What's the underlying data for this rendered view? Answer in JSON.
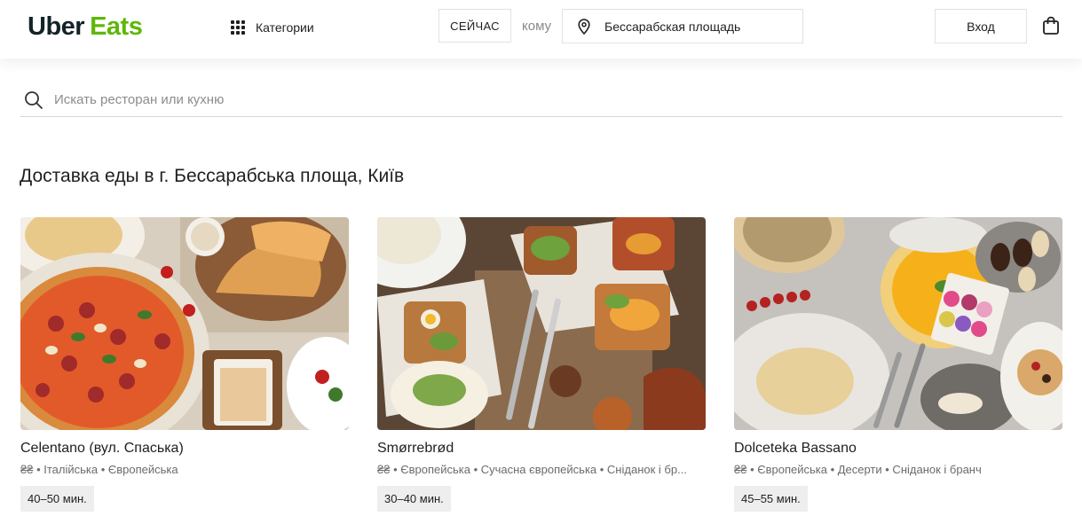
{
  "header": {
    "logo_uber": "Uber",
    "logo_eats": "Eats",
    "categories_label": "Категории",
    "now_label": "СЕЙЧАС",
    "to_label": "кому",
    "address": "Бессарабская площадь",
    "login_label": "Вход",
    "icons": [
      "grid-icon",
      "location-pin-icon",
      "shopping-bag-icon"
    ]
  },
  "search": {
    "placeholder": "Искать ресторан или кухню",
    "icon": "search-icon"
  },
  "main": {
    "title": "Доставка еды в г. Бессарабська площа, Київ",
    "restaurants": [
      {
        "name": "Celentano (вул. Спаська)",
        "tags": "₴₴ • Італійська • Європейська",
        "time": "40–50 мин."
      },
      {
        "name": "Smørrebrød",
        "tags": "₴₴ • Європейська • Сучасна європейська • Сніданок і бр...",
        "time": "30–40 мин."
      },
      {
        "name": "Dolceteka Bassano",
        "tags": "₴₴ • Європейська • Десерти • Сніданок і бранч",
        "time": "45–55 мин."
      }
    ]
  },
  "colors": {
    "brand_green": "#5fb709",
    "brand_dark": "#142328"
  }
}
